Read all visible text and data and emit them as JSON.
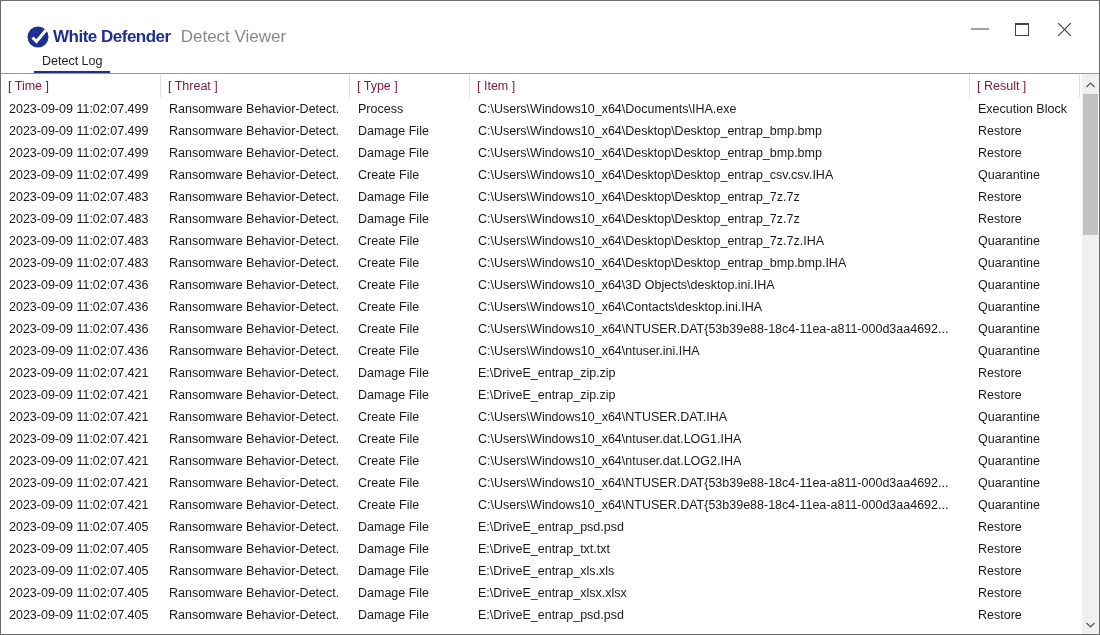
{
  "window": {
    "brand": "White Defender",
    "title": "Detect Viewer"
  },
  "tabs": [
    {
      "label": "Detect Log",
      "selected": true
    }
  ],
  "table": {
    "columns": [
      "[ Time ]",
      "[ Threat ]",
      "[ Type ]",
      "[ Item ]",
      "[ Result ]"
    ],
    "rows": [
      [
        "2023-09-09 11:02:07.499",
        "Ransomware Behavior-Detect.",
        "Process",
        "C:\\Users\\Windows10_x64\\Documents\\IHA.exe",
        "Execution Block"
      ],
      [
        "2023-09-09 11:02:07.499",
        "Ransomware Behavior-Detect.",
        "Damage File",
        "C:\\Users\\Windows10_x64\\Desktop\\Desktop_entrap_bmp.bmp",
        "Restore"
      ],
      [
        "2023-09-09 11:02:07.499",
        "Ransomware Behavior-Detect.",
        "Damage File",
        "C:\\Users\\Windows10_x64\\Desktop\\Desktop_entrap_bmp.bmp",
        "Restore"
      ],
      [
        "2023-09-09 11:02:07.499",
        "Ransomware Behavior-Detect.",
        "Create File",
        "C:\\Users\\Windows10_x64\\Desktop\\Desktop_entrap_csv.csv.IHA",
        "Quarantine"
      ],
      [
        "2023-09-09 11:02:07.483",
        "Ransomware Behavior-Detect.",
        "Damage File",
        "C:\\Users\\Windows10_x64\\Desktop\\Desktop_entrap_7z.7z",
        "Restore"
      ],
      [
        "2023-09-09 11:02:07.483",
        "Ransomware Behavior-Detect.",
        "Damage File",
        "C:\\Users\\Windows10_x64\\Desktop\\Desktop_entrap_7z.7z",
        "Restore"
      ],
      [
        "2023-09-09 11:02:07.483",
        "Ransomware Behavior-Detect.",
        "Create File",
        "C:\\Users\\Windows10_x64\\Desktop\\Desktop_entrap_7z.7z.IHA",
        "Quarantine"
      ],
      [
        "2023-09-09 11:02:07.483",
        "Ransomware Behavior-Detect.",
        "Create File",
        "C:\\Users\\Windows10_x64\\Desktop\\Desktop_entrap_bmp.bmp.IHA",
        "Quarantine"
      ],
      [
        "2023-09-09 11:02:07.436",
        "Ransomware Behavior-Detect.",
        "Create File",
        "C:\\Users\\Windows10_x64\\3D Objects\\desktop.ini.IHA",
        "Quarantine"
      ],
      [
        "2023-09-09 11:02:07.436",
        "Ransomware Behavior-Detect.",
        "Create File",
        "C:\\Users\\Windows10_x64\\Contacts\\desktop.ini.IHA",
        "Quarantine"
      ],
      [
        "2023-09-09 11:02:07.436",
        "Ransomware Behavior-Detect.",
        "Create File",
        "C:\\Users\\Windows10_x64\\NTUSER.DAT{53b39e88-18c4-11ea-a811-000d3aa4692...",
        "Quarantine"
      ],
      [
        "2023-09-09 11:02:07.436",
        "Ransomware Behavior-Detect.",
        "Create File",
        "C:\\Users\\Windows10_x64\\ntuser.ini.IHA",
        "Quarantine"
      ],
      [
        "2023-09-09 11:02:07.421",
        "Ransomware Behavior-Detect.",
        "Damage File",
        "E:\\DriveE_entrap_zip.zip",
        "Restore"
      ],
      [
        "2023-09-09 11:02:07.421",
        "Ransomware Behavior-Detect.",
        "Damage File",
        "E:\\DriveE_entrap_zip.zip",
        "Restore"
      ],
      [
        "2023-09-09 11:02:07.421",
        "Ransomware Behavior-Detect.",
        "Create File",
        "C:\\Users\\Windows10_x64\\NTUSER.DAT.IHA",
        "Quarantine"
      ],
      [
        "2023-09-09 11:02:07.421",
        "Ransomware Behavior-Detect.",
        "Create File",
        "C:\\Users\\Windows10_x64\\ntuser.dat.LOG1.IHA",
        "Quarantine"
      ],
      [
        "2023-09-09 11:02:07.421",
        "Ransomware Behavior-Detect.",
        "Create File",
        "C:\\Users\\Windows10_x64\\ntuser.dat.LOG2.IHA",
        "Quarantine"
      ],
      [
        "2023-09-09 11:02:07.421",
        "Ransomware Behavior-Detect.",
        "Create File",
        "C:\\Users\\Windows10_x64\\NTUSER.DAT{53b39e88-18c4-11ea-a811-000d3aa4692...",
        "Quarantine"
      ],
      [
        "2023-09-09 11:02:07.421",
        "Ransomware Behavior-Detect.",
        "Create File",
        "C:\\Users\\Windows10_x64\\NTUSER.DAT{53b39e88-18c4-11ea-a811-000d3aa4692...",
        "Quarantine"
      ],
      [
        "2023-09-09 11:02:07.405",
        "Ransomware Behavior-Detect.",
        "Damage File",
        "E:\\DriveE_entrap_psd.psd",
        "Restore"
      ],
      [
        "2023-09-09 11:02:07.405",
        "Ransomware Behavior-Detect.",
        "Damage File",
        "E:\\DriveE_entrap_txt.txt",
        "Restore"
      ],
      [
        "2023-09-09 11:02:07.405",
        "Ransomware Behavior-Detect.",
        "Damage File",
        "E:\\DriveE_entrap_xls.xls",
        "Restore"
      ],
      [
        "2023-09-09 11:02:07.405",
        "Ransomware Behavior-Detect.",
        "Damage File",
        "E:\\DriveE_entrap_xlsx.xlsx",
        "Restore"
      ],
      [
        "2023-09-09 11:02:07.405",
        "Ransomware Behavior-Detect.",
        "Damage File",
        "E:\\DriveE_entrap_psd.psd",
        "Restore"
      ]
    ]
  }
}
